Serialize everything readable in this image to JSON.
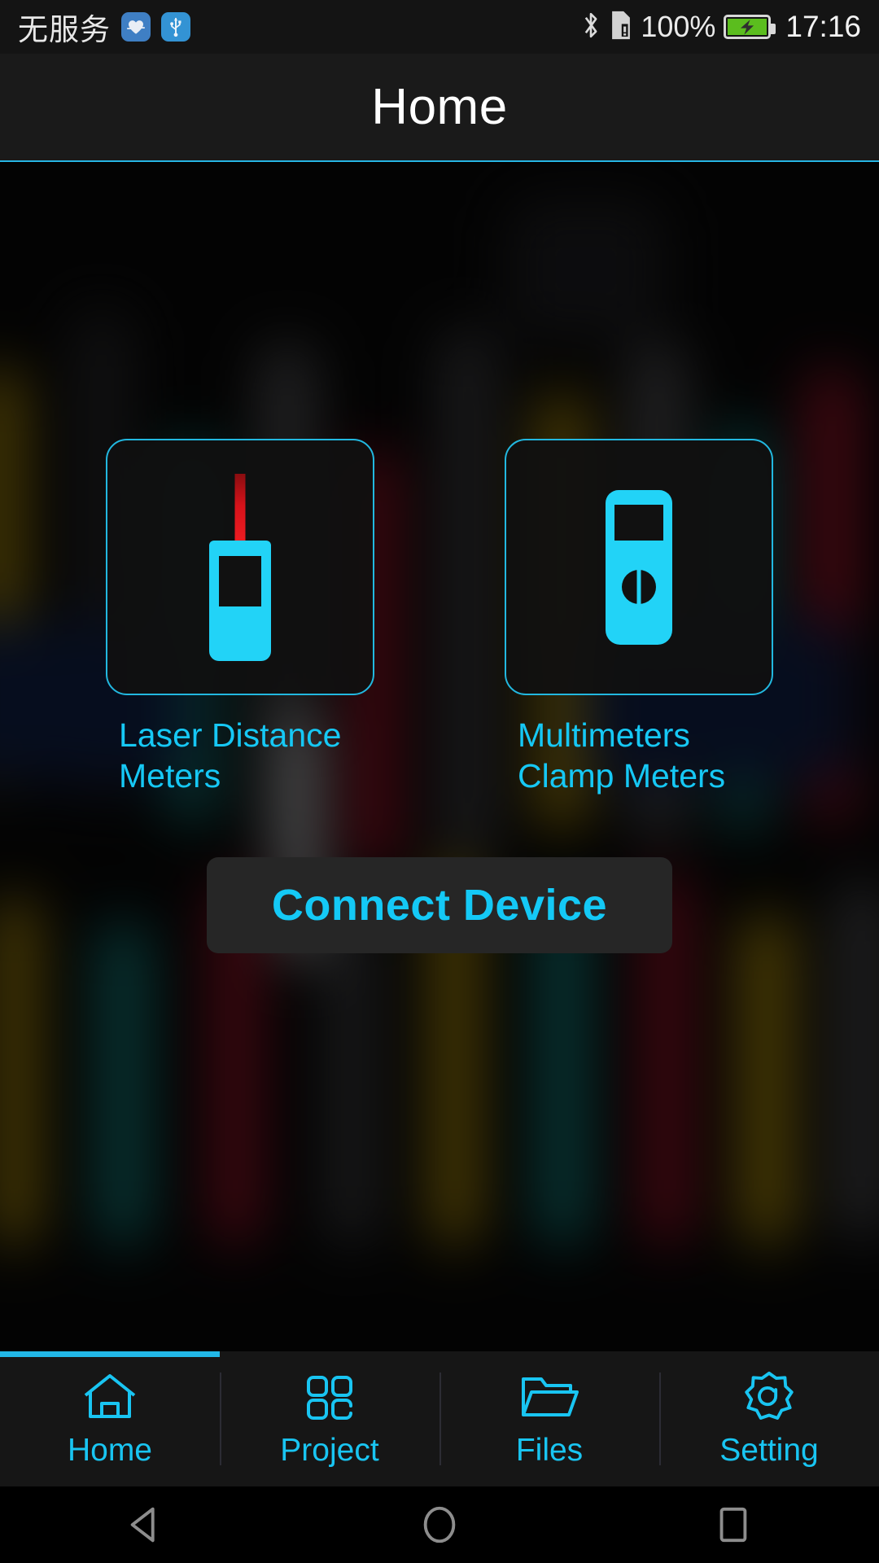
{
  "status_bar": {
    "carrier": "无服务",
    "battery_percent": "100%",
    "time": "17:16",
    "icons": [
      "health-app-icon",
      "usb-icon",
      "bluetooth-icon",
      "sim-card-icon",
      "battery-charging-icon"
    ]
  },
  "header": {
    "title": "Home"
  },
  "main": {
    "cards": [
      {
        "label": "Laser Distance Meters",
        "icon": "laser-distance-meter-icon"
      },
      {
        "label": "Multimeters Clamp Meters",
        "icon": "multimeter-icon"
      }
    ],
    "connect_button": "Connect Device"
  },
  "tabbar": {
    "items": [
      {
        "label": "Home",
        "icon": "home-icon",
        "active": true
      },
      {
        "label": "Project",
        "icon": "grid-icon",
        "active": false
      },
      {
        "label": "Files",
        "icon": "folder-icon",
        "active": false
      },
      {
        "label": "Setting",
        "icon": "gear-icon",
        "active": false
      }
    ]
  },
  "navbar": {
    "back": "back-triangle-icon",
    "home": "home-circle-icon",
    "recents": "recents-square-icon"
  },
  "colors": {
    "accent": "#16c8f5",
    "accent_border": "#22b8e0",
    "header_bg": "#1a1a1a",
    "button_bg": "#262626",
    "laser_red": "#ef1d22",
    "battery_green": "#5bbd1e"
  }
}
